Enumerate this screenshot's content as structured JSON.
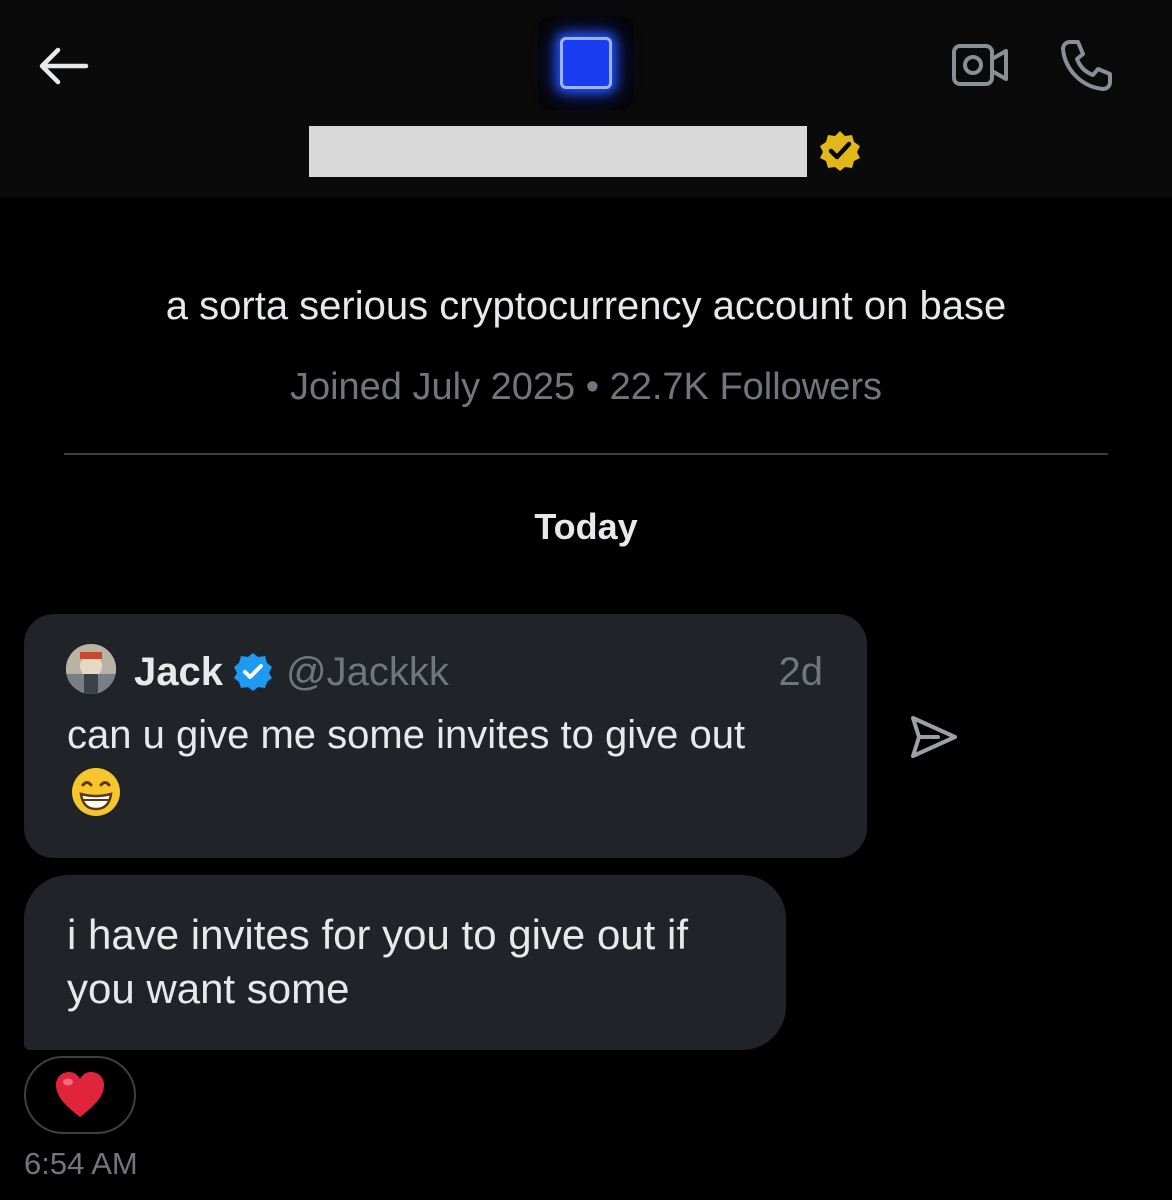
{
  "header": {
    "back_icon": "arrow-left-icon",
    "avatar_icon": "blue-glow-square-avatar",
    "display_name": "",
    "verified_badge": "gold-verified-badge",
    "video_icon": "video-camera-icon",
    "phone_icon": "phone-icon"
  },
  "profile": {
    "bio": "a sorta serious cryptocurrency account on base",
    "meta": "Joined July 2025 • 22.7K Followers"
  },
  "conversation": {
    "date_separator": "Today",
    "shared_post": {
      "author": "Jack",
      "verified": true,
      "handle": "@Jackkk",
      "age": "2d",
      "text": "can u give me some invites to give out",
      "emoji": "😁"
    },
    "share_icon": "send-arrow-icon",
    "message": {
      "text": "i have invites for you to give out if you want some",
      "reaction": "❤️",
      "time": "6:54 AM"
    }
  },
  "colors": {
    "background": "#000000",
    "header_bg": "#0a0a0a",
    "bubble_bg": "#202327",
    "muted_text": "#71767b",
    "primary_text": "#e7e9ea",
    "verified_gold": "#e2b719",
    "verified_blue": "#1d9bf0",
    "reaction_red": "#e0243b"
  }
}
